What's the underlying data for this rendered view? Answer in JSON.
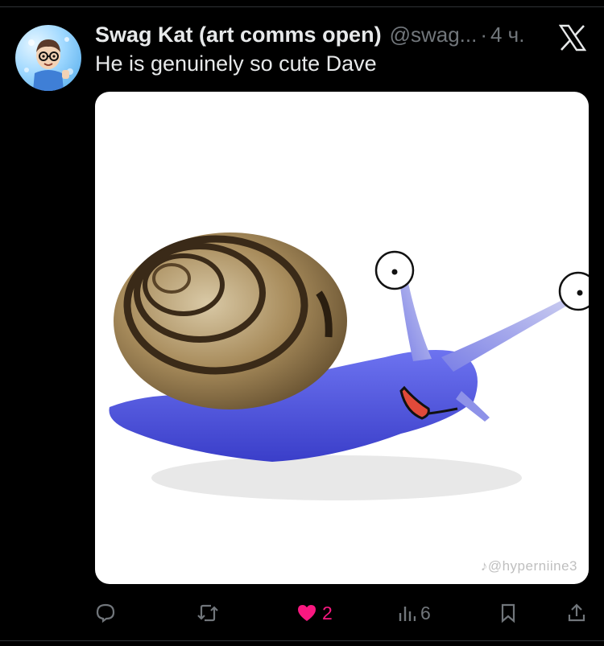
{
  "tweet": {
    "display_name": "Swag Kat (art comms open)",
    "handle": "@swag...",
    "separator": "·",
    "time": "4 ч.",
    "text": "He is genuinely so cute Dave"
  },
  "media": {
    "watermark": "♪@hyperniine3",
    "description_icon": "snail-image"
  },
  "actions": {
    "reply_count": "",
    "retweet_count": "",
    "like_count": "2",
    "views_count": "6"
  },
  "colors": {
    "background": "#000000",
    "text": "#e7e9ea",
    "muted": "#71767b",
    "like": "#f91880"
  },
  "icons": [
    "x-logo-icon",
    "reply-icon",
    "retweet-icon",
    "heart-icon",
    "views-icon",
    "bookmark-icon",
    "share-icon"
  ]
}
